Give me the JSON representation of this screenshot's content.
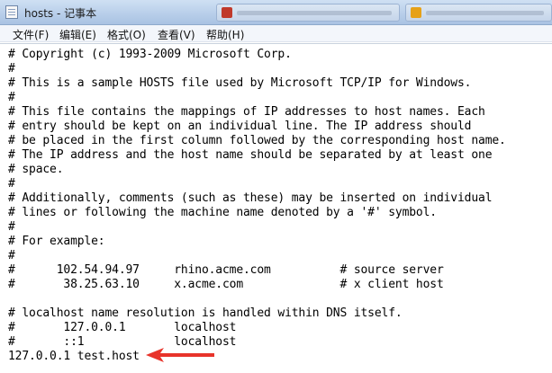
{
  "window": {
    "title": "hosts - 记事本",
    "app_icon": "notepad-icon",
    "background_tabs": [
      {
        "favicon_color": "#c0392b"
      },
      {
        "favicon_color": "#e6a118"
      }
    ]
  },
  "menu": [
    {
      "label": "文件(F)"
    },
    {
      "label": "编辑(E)"
    },
    {
      "label": "格式(O)"
    },
    {
      "label": "查看(V)"
    },
    {
      "label": "帮助(H)"
    }
  ],
  "editor": {
    "lines": [
      "# Copyright (c) 1993-2009 Microsoft Corp.",
      "#",
      "# This is a sample HOSTS file used by Microsoft TCP/IP for Windows.",
      "#",
      "# This file contains the mappings of IP addresses to host names. Each",
      "# entry should be kept on an individual line. The IP address should",
      "# be placed in the first column followed by the corresponding host name.",
      "# The IP address and the host name should be separated by at least one",
      "# space.",
      "#",
      "# Additionally, comments (such as these) may be inserted on individual",
      "# lines or following the machine name denoted by a '#' symbol.",
      "#",
      "# For example:",
      "#",
      "#      102.54.94.97     rhino.acme.com          # source server",
      "#       38.25.63.10     x.acme.com              # x client host",
      "",
      "# localhost name resolution is handled within DNS itself.",
      "#       127.0.0.1       localhost",
      "#       ::1             localhost",
      "127.0.0.1 test.host"
    ]
  },
  "annotation": {
    "arrow_color": "#e8332a",
    "arrow_icon": "red-arrow-icon"
  }
}
